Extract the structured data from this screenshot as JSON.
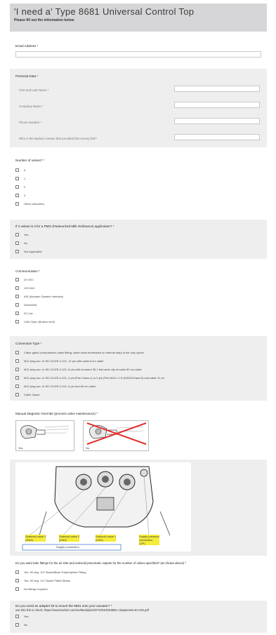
{
  "header": {
    "title": "'I need a' Type 8681 Universal Control Top",
    "subtitle": "Please fill out the information below"
  },
  "email": {
    "label": "Email Address *",
    "value": ""
  },
  "personal": {
    "label": "Personal Data *",
    "fields": [
      {
        "label": "First and Last Name *",
        "value": ""
      },
      {
        "label": "Company Name *",
        "value": ""
      },
      {
        "label": "Phone Number *",
        "value": ""
      },
      {
        "label": "Who is the Burkert contact that provided this survey link?",
        "value": ""
      }
    ]
  },
  "valves": {
    "label": "Number of valves? *",
    "options": [
      "0",
      "1",
      "2",
      "3",
      "Other (describe)"
    ]
  },
  "pmo": {
    "label": "If 3 valves is it for a PMO (Pasteurized Milk Ordinance) application? *",
    "options": [
      "Yes",
      "No",
      "Not Applicable"
    ]
  },
  "communication": {
    "label": "Communication *",
    "options": [
      "24 VDC",
      "120 VAC",
      "ASI (Actuator System Interface)",
      "DeviceNet",
      "IO Link",
      "CAN Open (Burkert buS)"
    ]
  },
  "connection": {
    "label": "Connection Type *",
    "options": [
      "Cable gland (compression cable fitting; cable wires terminated on internal strip) is the only option",
      "M12 plug acc. to IEC 61076-2-101, 12 pin with cable 8 cm cable",
      "M12 plug acc. to IEC 61076-2-101, 8 pin with mounted 35.1 flat cable clip at cable 80 cm cable",
      "M12 plug acc. to IEC 61076-2-101, 4 pol (Part Class-1) or 5 pin (Part M16 x 1.5 (DW22/Class B) and cable 11 cm",
      "M12 plug acc. to IEC 61076-2-101, 5 pin and 80 cm cable",
      "Cable Gland"
    ]
  },
  "override": {
    "label": "Manual Magnetic Override (process valve maintenance) *",
    "choices": [
      "Yes",
      "No"
    ]
  },
  "diagram": {
    "labels": [
      "Solenoid valve 3\n(2/A3)",
      "Solenoid valve 2\n(2/A2)",
      "Solenoid valve 1\n(2/A1)",
      "Supply pressure\nconnection\n(1/P)"
    ],
    "supply_text": "Supply connection"
  },
  "fittings": {
    "label": "Do you want tube fittings for the air inlet and solenoid pneumatic outputs for the number of valves specified? (as shown above) *",
    "options": [
      "Yes: 90 deg. 1/4\" Brass/Black Polybutylene Fitting",
      "Yes: 90 deg. 1/4\" Nickle Plated Brass",
      "No fittings required"
    ]
  },
  "adapter": {
    "label": "Do you need an adapter kit to mount the 8681 onto your actuator? *",
    "help": "use this link to check: https://www.burkert.com/en/Media/plm/DTS/DS/DS8681-Adaptersets-EU-EN.pdf",
    "options": [
      "Yes",
      "No"
    ]
  }
}
